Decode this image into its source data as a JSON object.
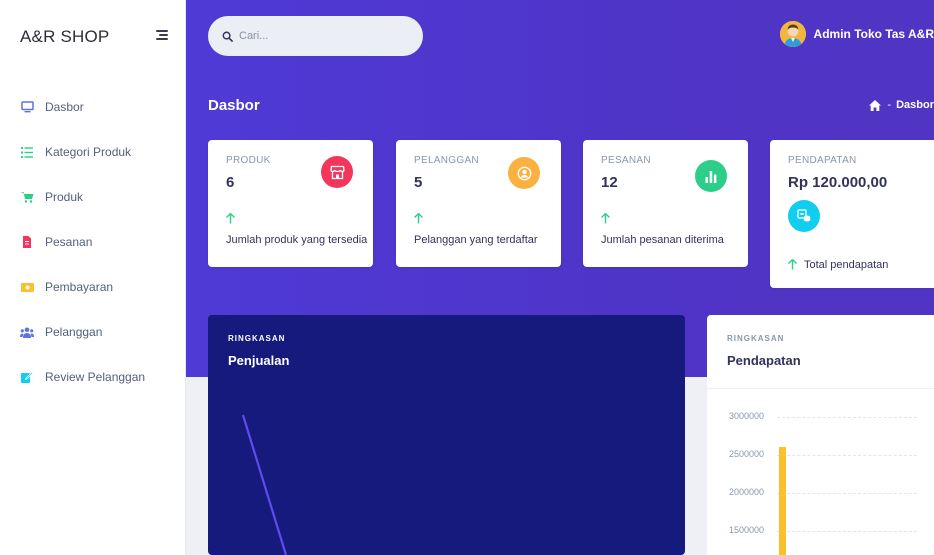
{
  "sidebar": {
    "brand": "A&R SHOP",
    "items": [
      {
        "label": "Dasbor",
        "icon": "monitor-icon",
        "color": "#5e72e4"
      },
      {
        "label": "Kategori Produk",
        "icon": "list-icon",
        "color": "#2dce89"
      },
      {
        "label": "Produk",
        "icon": "cart-icon",
        "color": "#2dce89"
      },
      {
        "label": "Pesanan",
        "icon": "receipt-icon",
        "color": "#f5365c"
      },
      {
        "label": "Pembayaran",
        "icon": "money-icon",
        "color": "#fbc02d"
      },
      {
        "label": "Pelanggan",
        "icon": "users-icon",
        "color": "#5e72e4"
      },
      {
        "label": "Review Pelanggan",
        "icon": "edit-icon",
        "color": "#11cdef"
      }
    ]
  },
  "header": {
    "search_placeholder": "Cari...",
    "user_name": "Admin Toko Tas A&R",
    "page_title": "Dasbor",
    "breadcrumb_sep": "-",
    "breadcrumb_current": "Dasbor"
  },
  "stats": [
    {
      "title": "PRODUK",
      "value": "6",
      "desc": "Jumlah produk yang tersedia",
      "icon": "store-icon",
      "color": "#f5365c"
    },
    {
      "title": "PELANGGAN",
      "value": "5",
      "desc": "Pelanggan yang terdaftar",
      "icon": "user-circle-icon",
      "color": "#fbb140"
    },
    {
      "title": "PESANAN",
      "value": "12",
      "desc": "Jumlah pesanan diterima",
      "icon": "chart-bar-icon",
      "color": "#2dce89"
    },
    {
      "title": "PENDAPATAN",
      "value": "Rp 120.000,00",
      "desc": "Total pendapatan",
      "icon": "money-stack-icon",
      "color": "#11cdef"
    }
  ],
  "sales_panel": {
    "label": "RINGKASAN",
    "title": "Penjualan"
  },
  "revenue_panel": {
    "label": "RINGKASAN",
    "title": "Pendapatan",
    "chart_data": {
      "type": "bar",
      "ticks": [
        "3000000",
        "2500000",
        "2000000",
        "1500000"
      ],
      "series": [
        {
          "values": [
            2600000
          ]
        }
      ],
      "ylim": [
        1500000,
        3000000
      ]
    }
  },
  "colors": {
    "header_bg": "#4f3ad6",
    "accent": "#5e72e4",
    "dark_panel": "#151a7c",
    "positive": "#2dce89"
  }
}
